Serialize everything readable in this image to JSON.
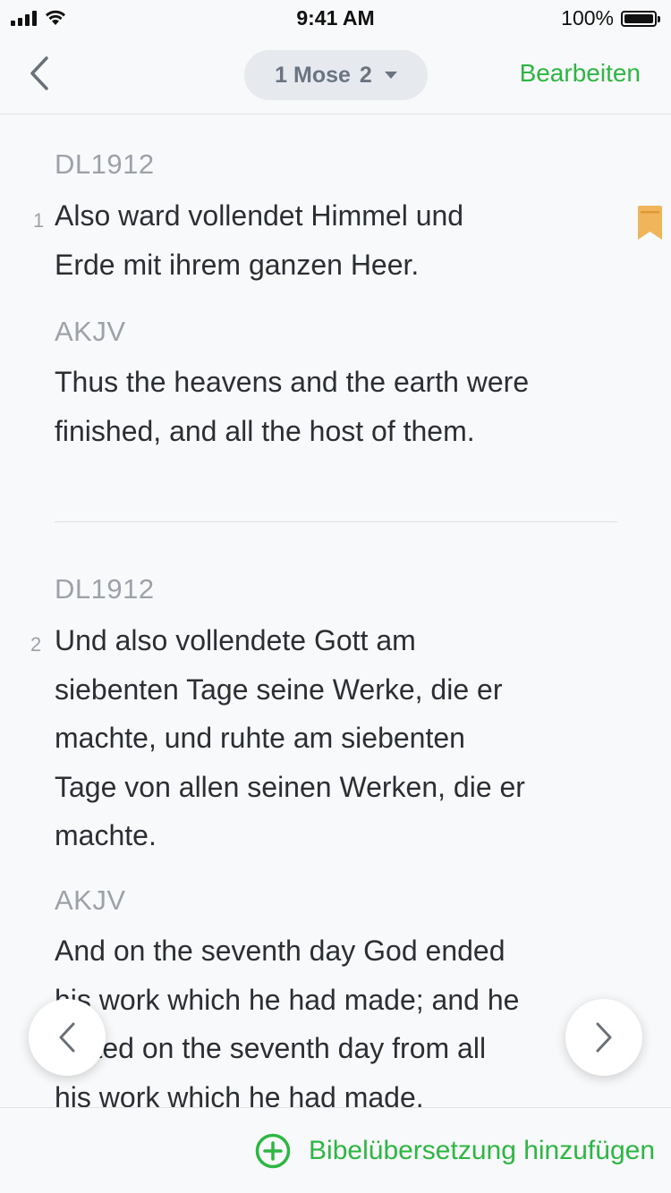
{
  "status_bar": {
    "time": "9:41 AM",
    "battery_percent": "100%",
    "battery_level": 1.0,
    "signal_bars": 4,
    "wifi": true
  },
  "nav": {
    "back_icon": "chevron-left-icon",
    "book": "1 Mose",
    "chapter": "2",
    "edit_label": "Bearbeiten"
  },
  "verses": [
    {
      "number": "1",
      "primary_translation": "DL1912",
      "primary_text": "Also ward vollendet Himmel und\nErde mit ihrem ganzen Heer.",
      "secondary_translation": "AKJV",
      "secondary_text": "Thus the heavens and the earth were\nfinished, and all the host of them.",
      "bookmarked": true
    },
    {
      "number": "2",
      "primary_translation": "DL1912",
      "primary_text": "Und also vollendete Gott am\nsiebenten Tage seine Werke, die er\nmachte, und ruhte am siebenten\nTage von allen seinen Werken, die er\nmachte.",
      "secondary_translation": "AKJV",
      "secondary_text": "And on the seventh day God ended\nhis work which he had made; and he\nrested on the seventh day from all\nhis work which he had made.",
      "bookmarked": false
    }
  ],
  "bottom_bar": {
    "add_icon": "plus-circle-icon",
    "add_label": "Bibelübersetzung hinzufügen"
  },
  "colors": {
    "accent": "#2db641",
    "bookmark": "#f0b55a",
    "muted_text": "#9da2a8",
    "body_text": "#2b2f33",
    "background": "#f8f9fa"
  }
}
